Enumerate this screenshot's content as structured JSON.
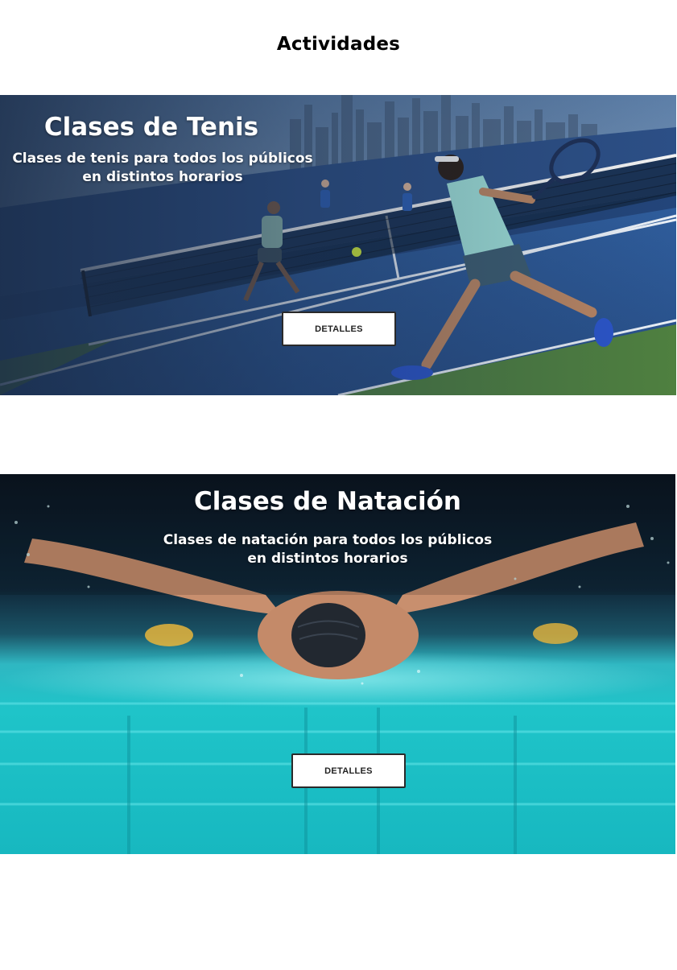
{
  "page": {
    "title": "Actividades"
  },
  "activities": [
    {
      "title": "Clases de Tenis",
      "subtitle_line1": "Clases de tenis para todos los públicos",
      "subtitle_line2": "en distintos horarios",
      "button_label": "DETALLES",
      "image": "tennis-players-photo"
    },
    {
      "title": "Clases de Natación",
      "subtitle_line1": "Clases de natación para todos los públicos",
      "subtitle_line2": "en distintos horarios",
      "button_label": "DETALLES",
      "image": "butterfly-swimmer-photo"
    }
  ],
  "colors": {
    "court_blue": "#2f5a98",
    "pool_turquoise": "#1fc4c9",
    "button_border": "#2a2a2a"
  }
}
